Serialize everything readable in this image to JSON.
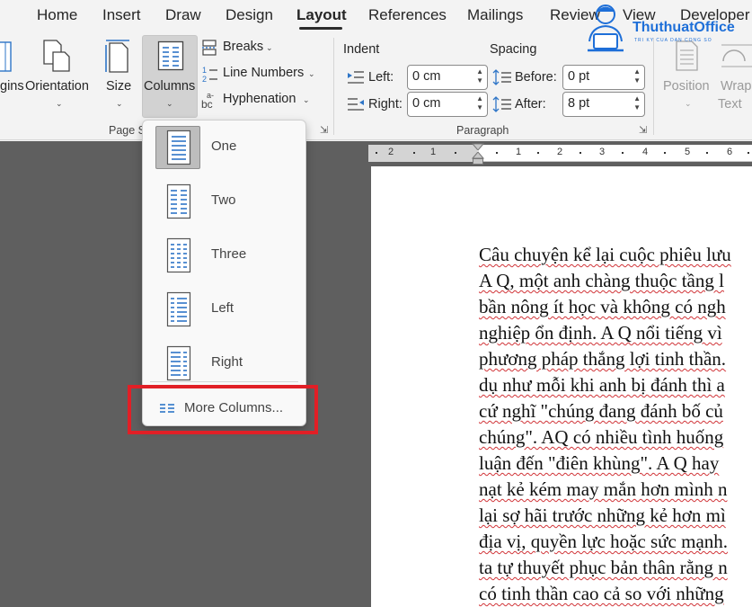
{
  "tabs": [
    "Home",
    "Insert",
    "Draw",
    "Design",
    "Layout",
    "References",
    "Mailings",
    "Review",
    "View",
    "Developer"
  ],
  "active_tab": "Layout",
  "ribbon": {
    "margins_label": "gins",
    "orientation_label": "Orientation",
    "size_label": "Size",
    "columns_label": "Columns",
    "breaks_label": "Breaks",
    "line_numbers_label": "Line Numbers",
    "hyphenation_label": "Hyphenation",
    "page_setup_group": "Page S",
    "indent_heading": "Indent",
    "indent_left_label": "Left:",
    "indent_left_value": "0 cm",
    "indent_right_label": "Right:",
    "indent_right_value": "0 cm",
    "spacing_heading": "Spacing",
    "spacing_before_label": "Before:",
    "spacing_before_value": "0 pt",
    "spacing_after_label": "After:",
    "spacing_after_value": "8 pt",
    "paragraph_group": "Paragraph",
    "position_label": "Position",
    "wrap_text_label_1": "Wrap",
    "wrap_text_label_2": "Text"
  },
  "columns_menu": {
    "items": [
      {
        "label": "One",
        "icon": "one-column-icon",
        "selected": true
      },
      {
        "label": "Two",
        "icon": "two-columns-icon",
        "selected": false
      },
      {
        "label": "Three",
        "icon": "three-columns-icon",
        "selected": false
      },
      {
        "label": "Left",
        "icon": "left-column-icon",
        "selected": false
      },
      {
        "label": "Right",
        "icon": "right-column-icon",
        "selected": false
      }
    ],
    "more_columns_label": "More Columns..."
  },
  "ruler_ticks": [
    "2",
    "1",
    "1",
    "2",
    "3",
    "4",
    "5",
    "6"
  ],
  "document_lines": [
    "Câu chuyện kể lại cuộc phiêu lưu",
    "A Q, một anh chàng thuộc tầng l",
    "bần nông ít học và không có ngh",
    "nghiệp ổn định. A Q nổi tiếng vì",
    "phương pháp thắng lợi tinh thần.",
    "dụ như mỗi khi anh bị đánh thì a",
    "cứ nghĩ \"chúng đang đánh bố củ",
    "chúng\". AQ có nhiều tình huống",
    "luận đến \"điên khùng\". A Q hay",
    "nạt kẻ kém may mắn hơn mình n",
    "lại sợ hãi trước những kẻ hơn mì",
    "địa vị, quyền lực hoặc sức mạnh.",
    "ta tự thuyết phục bản thân rằng n",
    "có tinh thần cao cả so với những"
  ],
  "logo": {
    "title": "ThuthuatOffice",
    "subtitle": "TRI KY CUA DAN CONG SO"
  },
  "colors": {
    "accent_text": "#262626",
    "highlight_box": "#e11f26",
    "logo_blue": "#1e6fd8",
    "spell_underline": "#d13438"
  }
}
